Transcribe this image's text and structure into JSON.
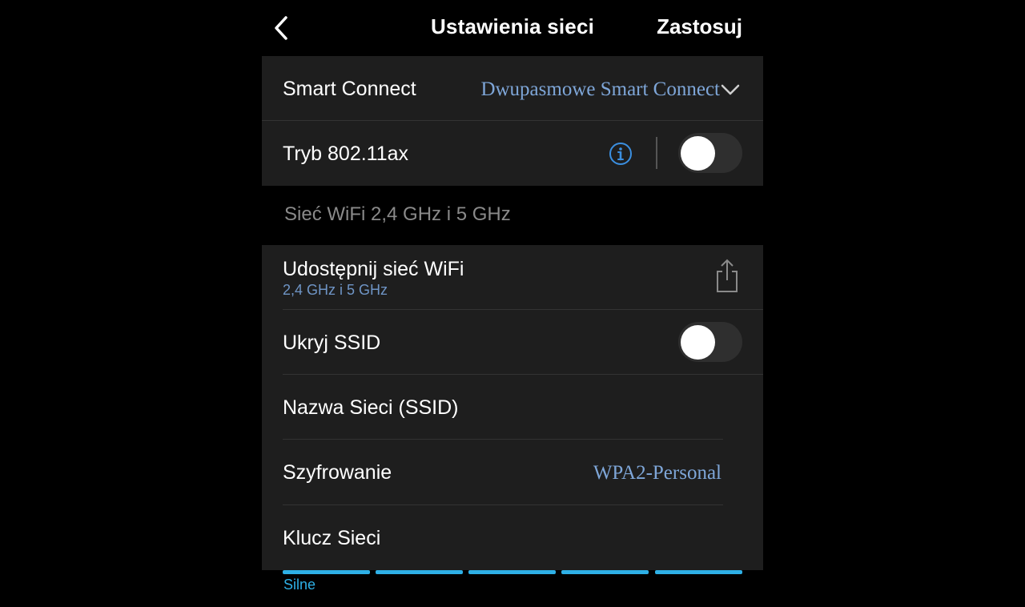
{
  "header": {
    "title": "Ustawienia sieci",
    "apply_label": "Zastosuj",
    "back_icon": "chevron-left-icon"
  },
  "smart_connect": {
    "label": "Smart Connect",
    "value": "Dwupasmowe Smart Connect",
    "icon": "chevron-down-icon"
  },
  "mode_ax": {
    "label": "Tryb 802.11ax",
    "info_icon": "info-icon",
    "enabled": false
  },
  "section": {
    "title": "Sieć WiFi 2,4 GHz i 5 GHz"
  },
  "share": {
    "label": "Udostępnij sieć WiFi",
    "sublabel": "2,4 GHz i 5 GHz",
    "icon": "share-icon"
  },
  "hide_ssid": {
    "label": "Ukryj SSID",
    "enabled": false
  },
  "ssid": {
    "label": "Nazwa Sieci (SSID)"
  },
  "encryption": {
    "label": "Szyfrowanie",
    "value": "WPA2-Personal"
  },
  "key": {
    "label": "Klucz Sieci",
    "strength_label": "Silne",
    "strength_segments": 5,
    "strength_filled": 5
  },
  "colors": {
    "accent": "#2eb0e6",
    "value_text": "#7ea6d8",
    "card_bg": "#1e1e1e"
  }
}
